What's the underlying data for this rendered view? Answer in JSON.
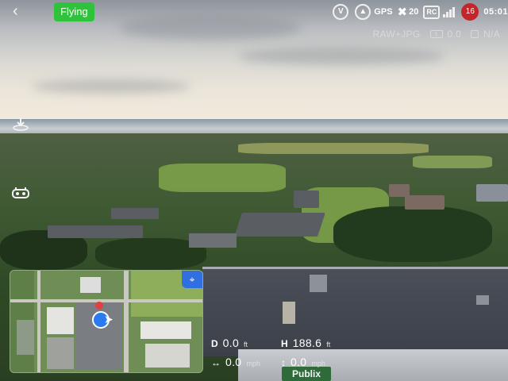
{
  "top_bar": {
    "back_icon": "chevron-left-icon",
    "flight_status": "Flying",
    "flight_status_color": "#2ec33a",
    "vision_icon": "vision-system-icon",
    "obstacle_icon": "obstacle-avoidance-icon",
    "gps_label": "GPS",
    "satellite_icon": "satellite-icon",
    "satellite_count": "20",
    "rc_label": "RC",
    "signal_icon": "signal-bars-icon",
    "battery_percent": "16",
    "battery_color": "#c4252a",
    "flight_time": "05:01"
  },
  "camera_info": {
    "format": "RAW+JPG",
    "ev_icon": "exposure-icon",
    "ev_value": "0.0",
    "sd_icon": "sd-card-icon",
    "storage": "N/A"
  },
  "side_controls": {
    "takeoff_icon": "auto-takeoff-landing-icon",
    "remote_icon": "remote-controller-icon"
  },
  "mini_map": {
    "locate_icon": "recenter-icon",
    "drone_icon": "drone-position-icon"
  },
  "telemetry": {
    "distance_label": "D",
    "distance_value": "0.0",
    "distance_unit": "ft",
    "height_label": "H",
    "height_value": "188.6",
    "height_unit": "ft",
    "h_speed_icon": "horizontal-speed-icon",
    "h_speed_value": "0.0",
    "h_speed_unit": "mph",
    "v_speed_icon": "vertical-speed-icon",
    "v_speed_value": "0.0",
    "v_speed_unit": "mph"
  },
  "scene": {
    "store_sign": "Publix"
  }
}
